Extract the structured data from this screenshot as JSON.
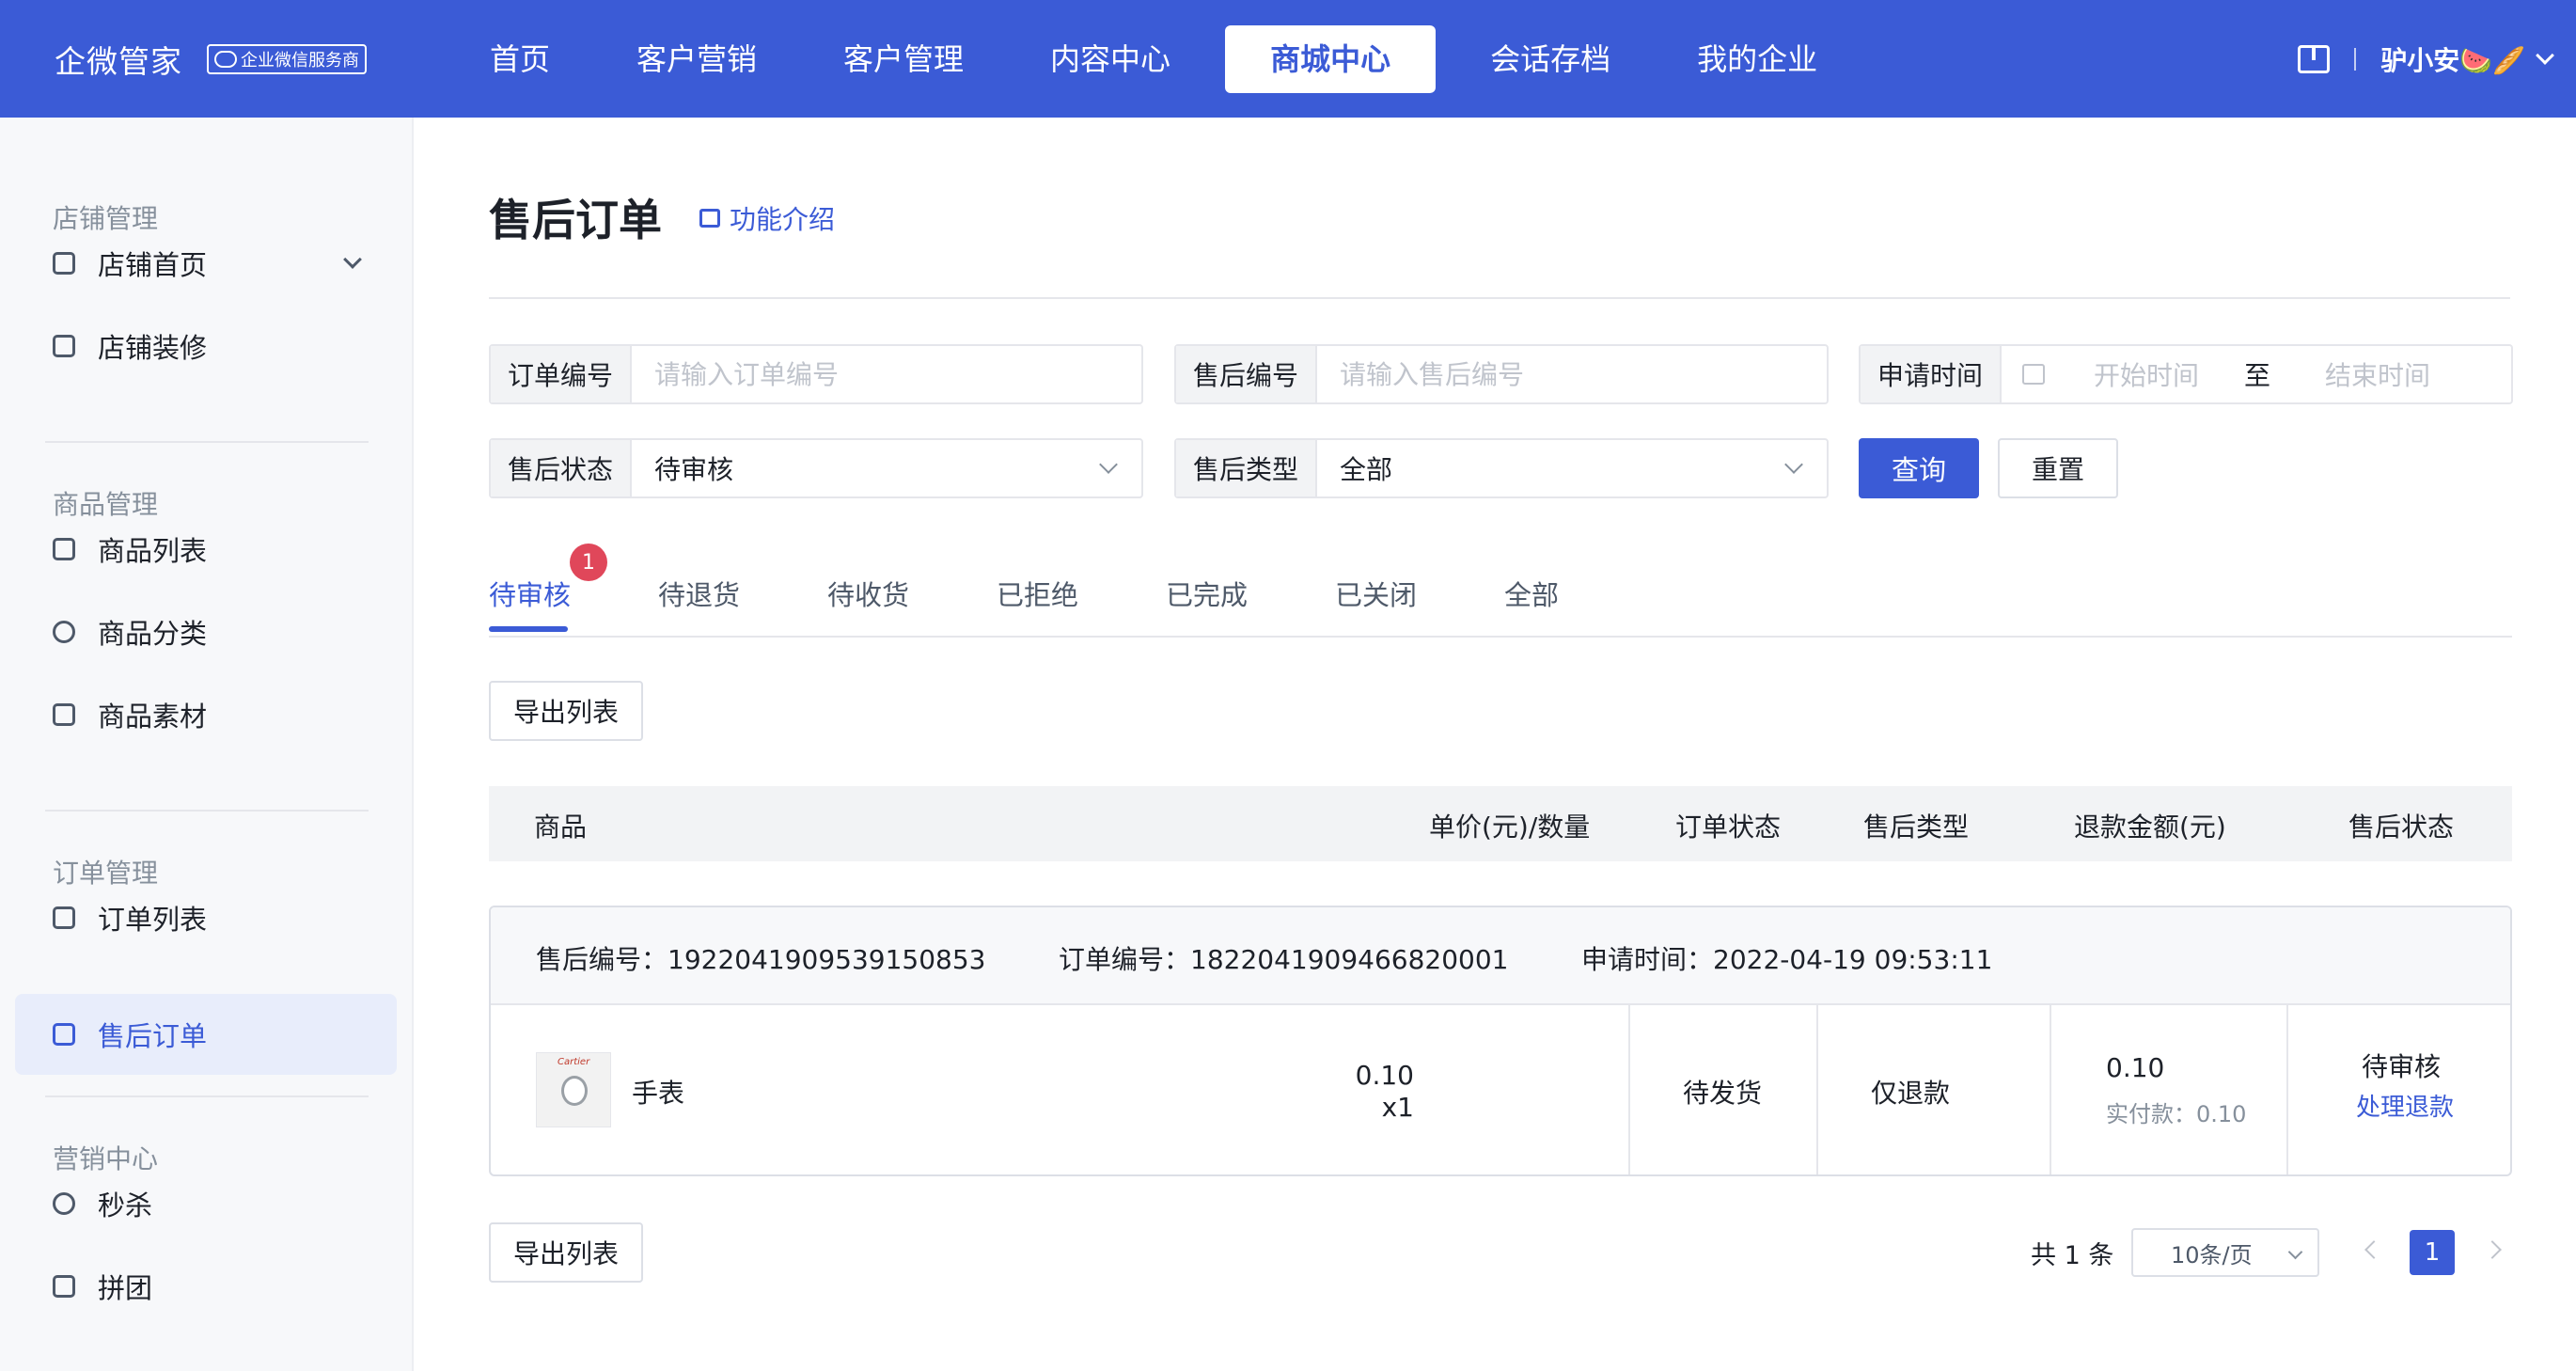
{
  "colors": {
    "brand": "#3b5bd6",
    "badge": "#e0475a"
  },
  "header": {
    "brand": "企微管家",
    "badge": "企业微信服务商",
    "nav": [
      "首页",
      "客户营销",
      "客户管理",
      "内容中心",
      "商城中心",
      "会话存档",
      "我的企业"
    ],
    "active_nav": "商城中心",
    "user": "驴小安🍉🥖"
  },
  "sidebar": {
    "groups": [
      {
        "title": "店铺管理",
        "items": [
          "店铺首页",
          "店铺装修"
        ]
      },
      {
        "title": "商品管理",
        "items": [
          "商品列表",
          "商品分类",
          "商品素材"
        ]
      },
      {
        "title": "订单管理",
        "items": [
          "订单列表",
          "售后订单"
        ]
      },
      {
        "title": "营销中心",
        "items": [
          "秒杀",
          "拼团"
        ]
      }
    ],
    "active_item": "售后订单"
  },
  "page": {
    "title": "售后订单",
    "intro_link": "功能介绍"
  },
  "filters": {
    "order_no": {
      "label": "订单编号",
      "placeholder": "请输入订单编号"
    },
    "aftersale_no": {
      "label": "售后编号",
      "placeholder": "请输入售后编号"
    },
    "apply_time": {
      "label": "申请时间",
      "start_placeholder": "开始时间",
      "separator": "至",
      "end_placeholder": "结束时间"
    },
    "status": {
      "label": "售后状态",
      "value": "待审核"
    },
    "type": {
      "label": "售后类型",
      "value": "全部"
    },
    "query_button": "查询",
    "reset_button": "重置"
  },
  "tabs": {
    "items": [
      "待审核",
      "待退货",
      "待收货",
      "已拒绝",
      "已完成",
      "已关闭",
      "全部"
    ],
    "active": "待审核",
    "badge_count": "1"
  },
  "export_button": "导出列表",
  "table": {
    "columns": [
      "商品",
      "单价(元)/数量",
      "订单状态",
      "售后类型",
      "退款金额(元)",
      "售后状态"
    ]
  },
  "orders": [
    {
      "aftersale_no_text": "售后编号：1922041909539150853",
      "order_no_text": "订单编号：1822041909466820001",
      "apply_time_text": "申请时间：2022-04-19 09:53:11",
      "product_name": "手表",
      "product_brand_mark": "Cartier",
      "unit_price": "0.10",
      "quantity": "x1",
      "order_status": "待发货",
      "aftersale_type": "仅退款",
      "refund_amount": "0.10",
      "paid_text": "实付款：0.10",
      "aftersale_status": "待审核",
      "action": "处理退款"
    }
  ],
  "pagination": {
    "total_text": "共 1 条",
    "page_size": "10条/页",
    "current_page": "1"
  }
}
